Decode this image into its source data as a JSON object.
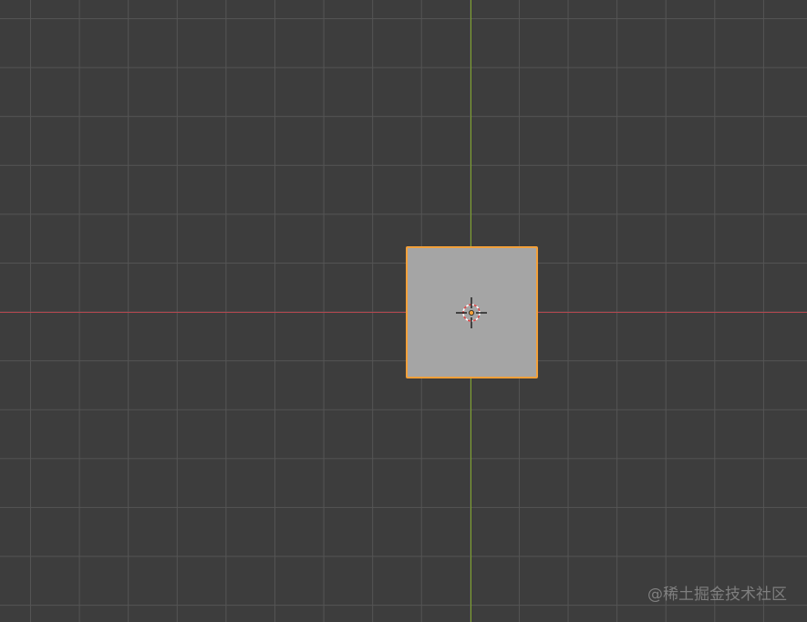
{
  "viewport": {
    "background_color": "#3d3d3d",
    "grid_color": "#545454",
    "x_axis_color": "#b3474f",
    "y_axis_color": "#7fa52a"
  },
  "selected_object": {
    "shape": "cube",
    "fill_color": "#a5a5a5",
    "outline_color": "#f2a03a"
  },
  "cursor": {
    "icon": "3d-cursor-icon",
    "ring_colors": [
      "#e04a4a",
      "#ffffff"
    ],
    "origin_color": "#f2a03a"
  },
  "watermark": {
    "text": "@稀土掘金技术社区"
  }
}
